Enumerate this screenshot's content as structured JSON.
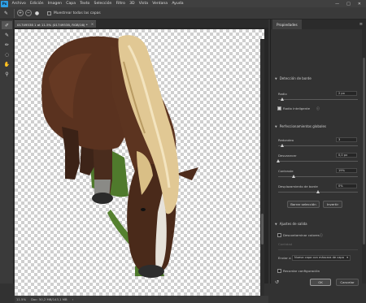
{
  "menubar": {
    "logo": "Ps",
    "items": [
      "Archivo",
      "Edición",
      "Imagen",
      "Capa",
      "Texto",
      "Selección",
      "Filtro",
      "3D",
      "Vista",
      "Ventana",
      "Ayuda"
    ],
    "controls": [
      "—",
      "□",
      "✕"
    ]
  },
  "options": {
    "sample_all_layers_label": "Muestrear todas las capas"
  },
  "document": {
    "tab_title": "01749538 1 at 11.5% (01749538, RGB/16) *",
    "zoom": "11.5%",
    "doc_info": "Doc: 50,2 MB/143,1 MB"
  },
  "properties": {
    "tab_label": "Propiedades",
    "edge_detection": {
      "title": "Detección de borde",
      "radius_label": "Radio",
      "radius_value": "2 px",
      "radius_fraction": 0.05,
      "smart_radius_label": "Radio inteligente",
      "smart_radius_checked": true
    },
    "global_refinements": {
      "title": "Perfeccionamientos globales",
      "smooth_label": "Redondeo",
      "smooth_value": "3",
      "smooth_fraction": 0.05,
      "feather_label": "Desvanecer",
      "feather_value": "0,0 px",
      "feather_fraction": 0.0,
      "contrast_label": "Contraste",
      "contrast_value": "19%",
      "contrast_fraction": 0.19,
      "shift_edge_label": "Desplazamiento de borde",
      "shift_edge_value": "0%",
      "shift_edge_fraction": 0.5,
      "clear_selection_label": "Borrar selección",
      "invert_label": "Invertir"
    },
    "output_settings": {
      "title": "Ajustes de salida",
      "decontaminate_label": "Descontaminar colores",
      "decontaminate_checked": false,
      "amount_label": "Cantidad",
      "output_to_label": "Enviar a",
      "output_to_value": "Nueva capa con máscara de capa",
      "remember_label": "Recordar configuración",
      "remember_checked": false
    },
    "ok_label": "OK",
    "cancel_label": "Cancelar"
  }
}
